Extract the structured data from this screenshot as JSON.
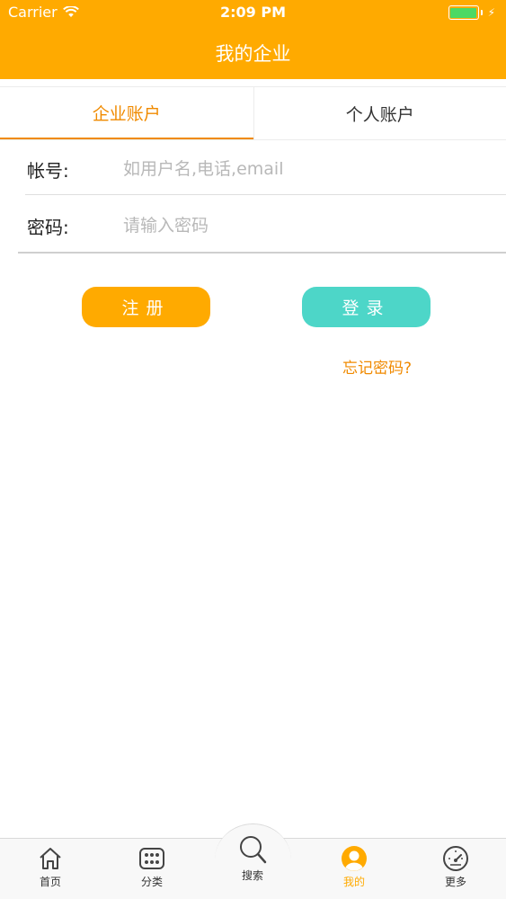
{
  "status_bar": {
    "carrier": "Carrier",
    "time": "2:09 PM"
  },
  "nav": {
    "title": "我的企业"
  },
  "tabs": [
    {
      "label": "企业账户",
      "active": true
    },
    {
      "label": "个人账户",
      "active": false
    }
  ],
  "form": {
    "account_label": "帐号:",
    "account_placeholder": "如用户名,电话,email",
    "password_label": "密码:",
    "password_placeholder": "请输入密码"
  },
  "buttons": {
    "register": "注册",
    "login": "登录"
  },
  "forgot_link": "忘记密码?",
  "tabbar": [
    {
      "label": "首页",
      "icon": "home-icon"
    },
    {
      "label": "分类",
      "icon": "grid-icon"
    },
    {
      "label": "搜索",
      "icon": "search-icon"
    },
    {
      "label": "我的",
      "icon": "user-icon",
      "active": true
    },
    {
      "label": "更多",
      "icon": "speedometer-icon"
    }
  ],
  "colors": {
    "primary": "#FFAA00",
    "accent_text": "#F08A00",
    "login": "#4DD6C8",
    "battery": "#4CD964"
  }
}
